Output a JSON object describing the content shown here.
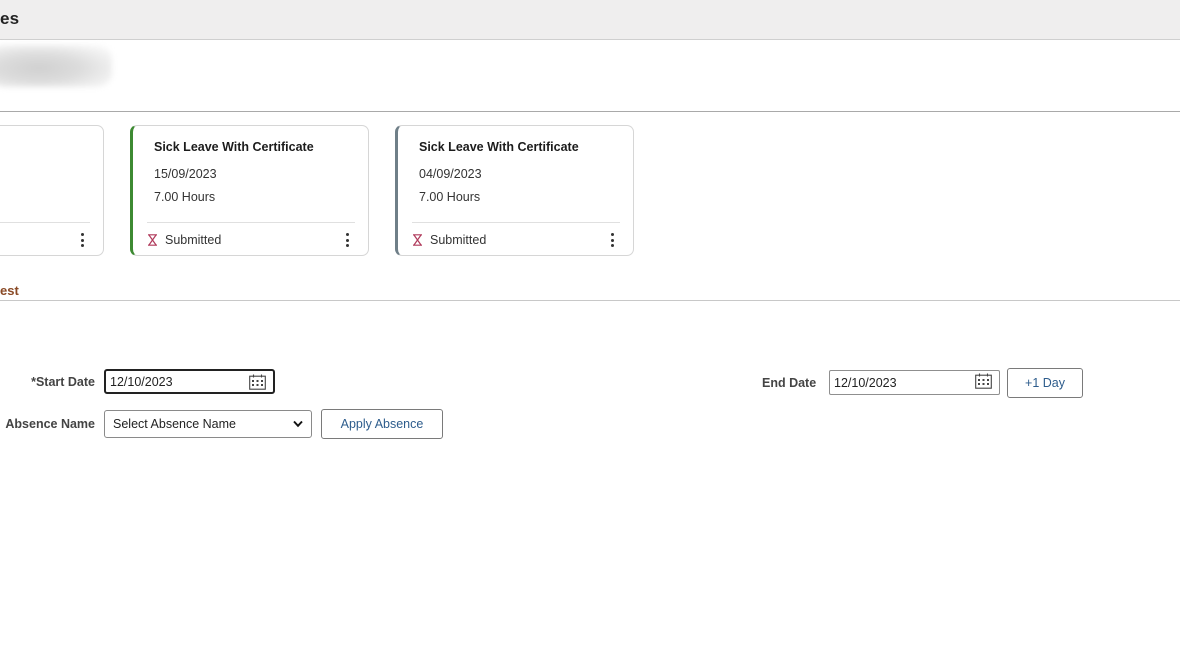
{
  "header": {
    "title": "es"
  },
  "cards": [
    {
      "title": "",
      "date": "",
      "hours": "",
      "status": ""
    },
    {
      "title": "Sick Leave With Certificate",
      "date": "15/09/2023",
      "hours": "7.00 Hours",
      "status": "Submitted",
      "accent_color": "#3d8a32"
    },
    {
      "title": "Sick Leave With Certificate",
      "date": "04/09/2023",
      "hours": "7.00 Hours",
      "status": "Submitted",
      "accent_color": "#6f7f88"
    }
  ],
  "section": {
    "heading": "est"
  },
  "form": {
    "start_date_label": "*Start Date",
    "start_date_value": "12/10/2023",
    "end_date_label": "End Date",
    "end_date_value": "12/10/2023",
    "plus_day_label": "+1 Day",
    "absence_name_label": "Absence Name",
    "absence_name_selected": "Select Absence Name",
    "apply_label": "Apply Absence"
  },
  "icons": {
    "calendar": "calendar-icon",
    "hourglass": "hourglass-icon",
    "kebab": "kebab-menu-icon",
    "chevron": "chevron-down-icon"
  },
  "colors": {
    "section_heading": "#8a4a26",
    "button_text": "#2d5c8c",
    "status_icon": "#b03a5b"
  }
}
